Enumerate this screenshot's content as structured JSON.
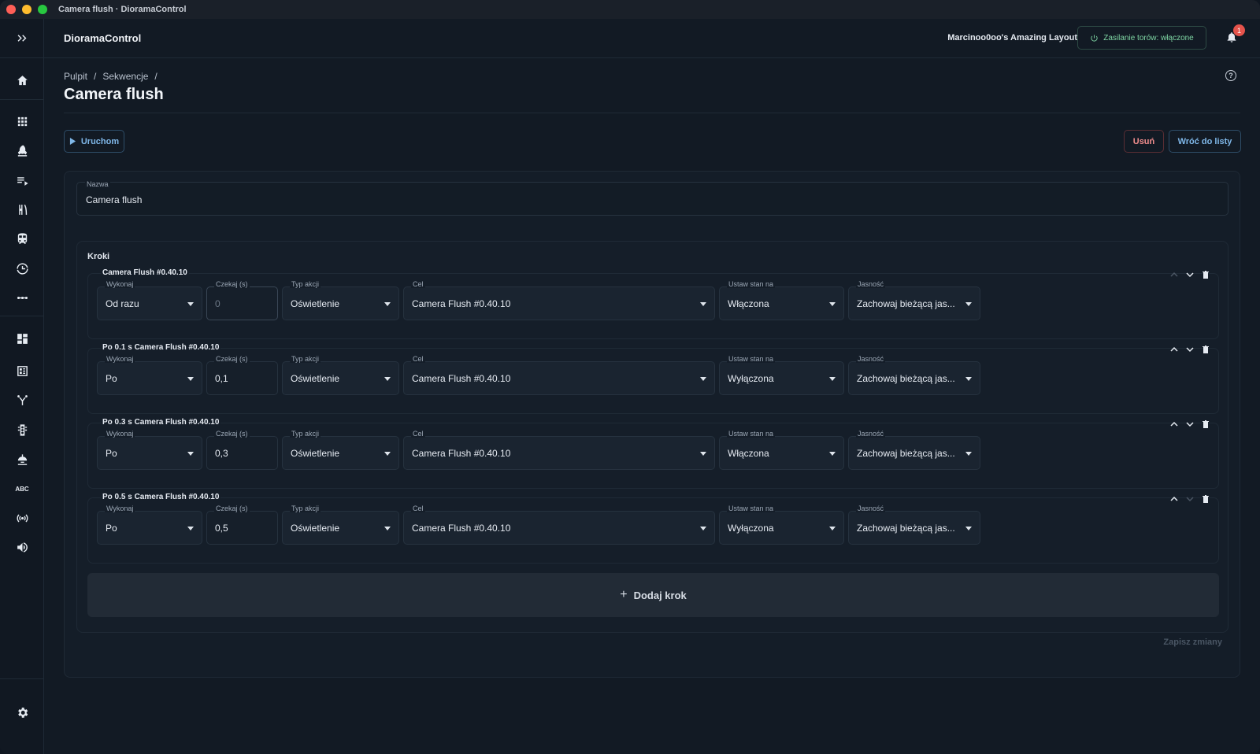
{
  "window": {
    "title": "Camera flush · DioramaControl"
  },
  "topbar": {
    "brand": "DioramaControl",
    "layout_name": "Marcinoo0oo's Amazing Layout",
    "power_label": "Zasilanie torów: włączone",
    "notification_count": "1"
  },
  "breadcrumb": {
    "items": [
      "Pulpit",
      "/",
      "Sekwencje",
      "/"
    ]
  },
  "page": {
    "title": "Camera flush",
    "help": "?"
  },
  "actions": {
    "run": "Uruchom",
    "delete": "Usuń",
    "back": "Wróć do listy"
  },
  "form": {
    "name_label": "Nazwa",
    "name_value": "Camera flush",
    "steps_title": "Kroki",
    "labels": {
      "wykonaj": "Wykonaj",
      "czekaj": "Czekaj (s)",
      "typ": "Typ akcji",
      "cel": "Cel",
      "ustaw": "Ustaw stan na",
      "jasnosc": "Jasność"
    },
    "steps": [
      {
        "title": "Camera Flush #0.40.10",
        "wykonaj": "Od razu",
        "czekaj": "0",
        "typ": "Oświetlenie",
        "cel": "Camera Flush #0.40.10",
        "ustaw": "Włączona",
        "jasnosc": "Zachowaj bieżącą jas..."
      },
      {
        "title": "Po 0.1 s Camera Flush #0.40.10",
        "wykonaj": "Po",
        "czekaj": "0,1",
        "typ": "Oświetlenie",
        "cel": "Camera Flush #0.40.10",
        "ustaw": "Wyłączona",
        "jasnosc": "Zachowaj bieżącą jas..."
      },
      {
        "title": "Po 0.3 s Camera Flush #0.40.10",
        "wykonaj": "Po",
        "czekaj": "0,3",
        "typ": "Oświetlenie",
        "cel": "Camera Flush #0.40.10",
        "ustaw": "Włączona",
        "jasnosc": "Zachowaj bieżącą jas..."
      },
      {
        "title": "Po 0.5 s Camera Flush #0.40.10",
        "wykonaj": "Po",
        "czekaj": "0,5",
        "typ": "Oświetlenie",
        "cel": "Camera Flush #0.40.10",
        "ustaw": "Wyłączona",
        "jasnosc": "Zachowaj bieżącą jas..."
      }
    ],
    "add_step": "Dodaj krok",
    "save": "Zapisz zmiany"
  },
  "sidebar": {
    "icons": [
      "expand-icon",
      "home-icon",
      "apps-grid-icon",
      "rocket-icon",
      "playlist-icon",
      "turnout-icon",
      "train-icon",
      "turntable-icon",
      "dots-icon",
      "dashboard-icon",
      "layout-panel-icon",
      "route-icon",
      "signal-icon",
      "lamp-icon",
      "abc-icon",
      "broadcast-icon",
      "volume-icon",
      "settings-icon"
    ],
    "abc_text": "ABC"
  },
  "colors": {
    "accent": "#7fb7e8",
    "power_on": "#7fd6a4",
    "danger": "#f08d8d",
    "badge": "#e5534b"
  }
}
